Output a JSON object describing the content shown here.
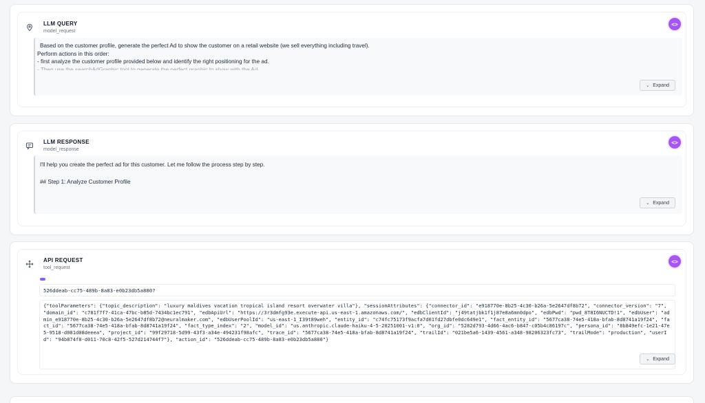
{
  "cards": [
    {
      "title": "LLM QUERY",
      "subtitle": "model_request",
      "icon": "location-pin-icon",
      "lines": [
        "Based on the customer profile, generate the perfect Ad to show the customer on a retail website (we sell everything including travel).",
        "Perform actions in this order:",
        "- first analyze the customer profile provided below and identify the right positioning for the ad.",
        "- Then use the searchAdGraphic tool to generate the perfect graphic to show with the Ad."
      ],
      "expand_label": "Expand",
      "code_label": "<>"
    },
    {
      "title": "LLM RESPONSE",
      "subtitle": "model_response",
      "icon": "chat-icon",
      "lines": [
        "I'll help you create the perfect ad for this customer. Let me follow the process step by step.",
        "",
        "## Step 1: Analyze Customer Profile"
      ],
      "expand_label": "Expand",
      "code_label": "<>"
    },
    {
      "title": "API REQUEST",
      "subtitle": "tool_request",
      "icon": "move-icon",
      "action_id_line": "526ddeab-cc75-489b-8a83-e0b23db5a880?",
      "json_text": "{\"toolParameters\": {\"topic_description\": \"luxury maldives vacation tropical island resort overwater villa\"}, \"sessionAttributes\": {\"connector_id\": \"e918770e-8b25-4c30-b26a-5e2647df8b72\", \"connector_version\": \"7\", \"domain_id\": \"c781f7f7-41ca-47bc-b85d-7434bc1ec791\", \"edbApiUrl\": \"https://3r3dmfg93e.execute-api.us-east-1.amazonaws.com/\", \"edbClientId\": \"j49tatjbk1f1j87e8a6mn0dpo\", \"edbPwd\": \"pwd_8T8I6NUCTD!1\", \"edbUser\": \"admin_e918770e-8b25-4c30-b26a-5e2647df8b72@neuralmaker.com\", \"edbUserPoolId\": \"us-east-1_I39t89weh\", \"entity_id\": \"c74fc75173f9acfa7d01fd27dbfe0dc649e1\", \"fact_entity_id\": \"5677ca38-74e5-418a-bfab-8d8741a19f24\", \"fact_id\": \"5677ca38-74e5-418a-bfab-8d8741a19f24\", \"fact_type_index\": \"2\", \"model_id\": \"us.anthropic.claude-haiku-4-5-20251001-v1:0\", \"org_id\": \"5282d793-4d66-4ac6-b847-c05b4c86197c\", \"persona_id\": \"8b849efc-1e21-47e5-9518-d081d08deeea\", \"project_id\": \"99f29718-5d99-43f3-a34e-494231f98afc\", \"trace_id\": \"5677ca38-74e5-418a-bfab-8d8741a19f24\", \"trailId\": \"021be5a6-1439-4561-a348-98206323fc73\", \"trailMode\": \"production\", \"userId\": \"94b874f8-d011-70c8-42f5-527d214744f7\"}, \"action_id\": \"526ddeab-cc75-489b-8a83-e0b23db5a880\"}",
      "expand_label": "Expand",
      "code_label": "<>"
    }
  ],
  "colors": {
    "accent": "#a855f7",
    "pill": "#8b5cf6",
    "border": "#e6e8ec"
  }
}
